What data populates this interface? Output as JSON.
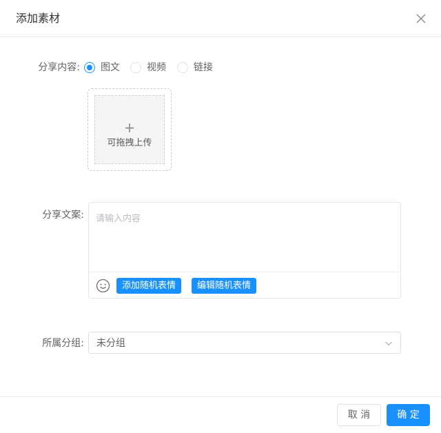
{
  "dialog": {
    "title": "添加素材",
    "close_icon": "close-icon"
  },
  "share_content": {
    "label": "分享内容:",
    "options": [
      {
        "label": "图文",
        "checked": true
      },
      {
        "label": "视频",
        "checked": false
      },
      {
        "label": "链接",
        "checked": false
      }
    ]
  },
  "upload": {
    "plus": "+",
    "text": "可拖拽上传"
  },
  "share_text": {
    "label": "分享文案:",
    "placeholder": "请输入内容",
    "emoji_icon": "smile-icon",
    "add_random_emoji": "添加随机表情",
    "edit_random_emoji": "编辑随机表情"
  },
  "group": {
    "label": "所属分组:",
    "value": "未分组",
    "arrow_icon": "chevron-down-icon"
  },
  "footer": {
    "cancel": "取 消",
    "confirm": "确 定"
  },
  "colors": {
    "primary": "#1890ff",
    "border": "#dcdfe6",
    "text": "#606266"
  }
}
